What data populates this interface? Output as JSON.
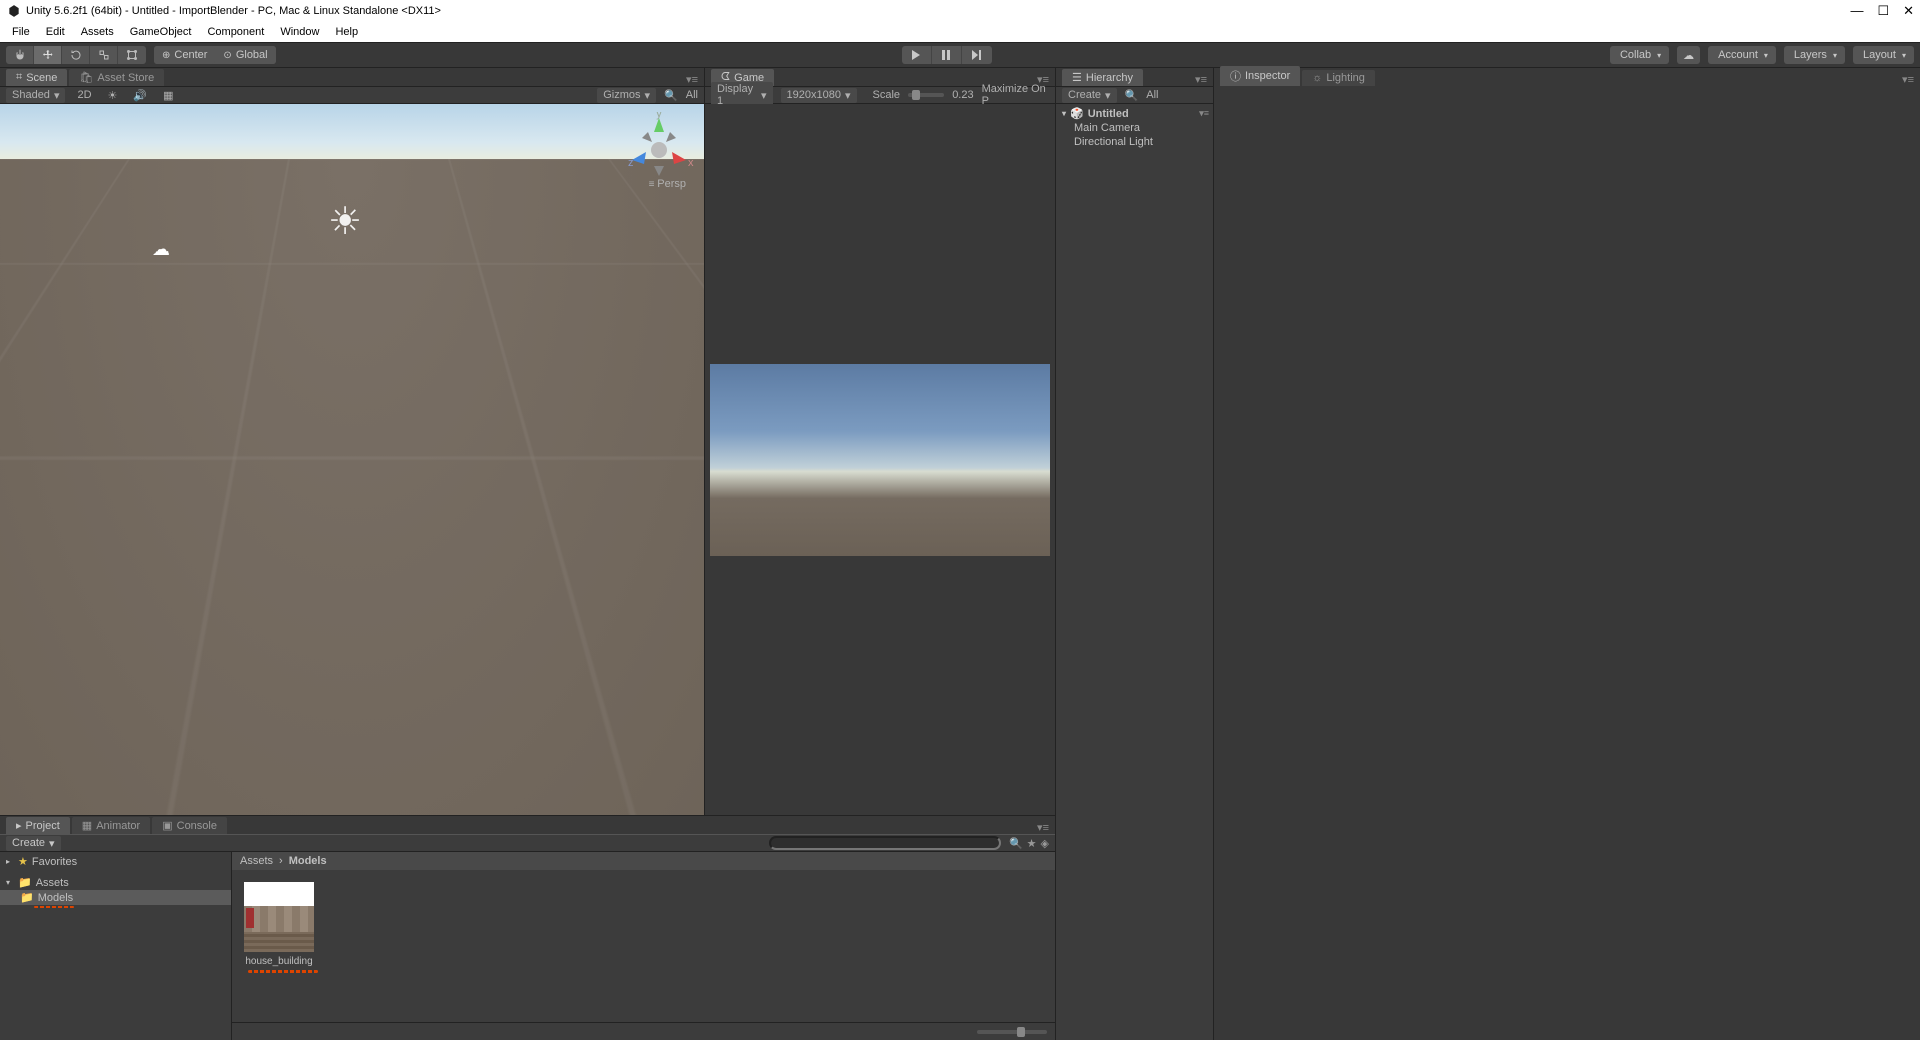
{
  "window": {
    "title": "Unity 5.6.2f1 (64bit) - Untitled - ImportBlender - PC, Mac & Linux Standalone <DX11>",
    "controls": {
      "min": "—",
      "max": "☐",
      "close": "✕"
    }
  },
  "menu": [
    "File",
    "Edit",
    "Assets",
    "GameObject",
    "Component",
    "Window",
    "Help"
  ],
  "toolbar": {
    "handle_center": "Center",
    "handle_global": "Global",
    "collab": "Collab",
    "account": "Account",
    "layers": "Layers",
    "layout": "Layout"
  },
  "scene": {
    "tab": "Scene",
    "tab2": "Asset Store",
    "shading": "Shaded",
    "twod": "2D",
    "gizmos": "Gizmos",
    "search_all": "All",
    "persp": "Persp"
  },
  "game": {
    "tab": "Game",
    "display": "Display 1",
    "resolution": "1920x1080",
    "scale_label": "Scale",
    "scale_value": "0.23",
    "maximize": "Maximize On P"
  },
  "hierarchy": {
    "tab": "Hierarchy",
    "create": "Create",
    "search_all": "All",
    "scene_name": "Untitled",
    "items": [
      "Main Camera",
      "Directional Light"
    ]
  },
  "inspector": {
    "tab": "Inspector",
    "tab2": "Lighting"
  },
  "project": {
    "tab": "Project",
    "tab2": "Animator",
    "tab3": "Console",
    "create": "Create",
    "favorites": "Favorites",
    "assets": "Assets",
    "models": "Models",
    "breadcrumb_root": "Assets",
    "breadcrumb_sep": "›",
    "breadcrumb_cur": "Models",
    "asset_name": "house_building"
  }
}
